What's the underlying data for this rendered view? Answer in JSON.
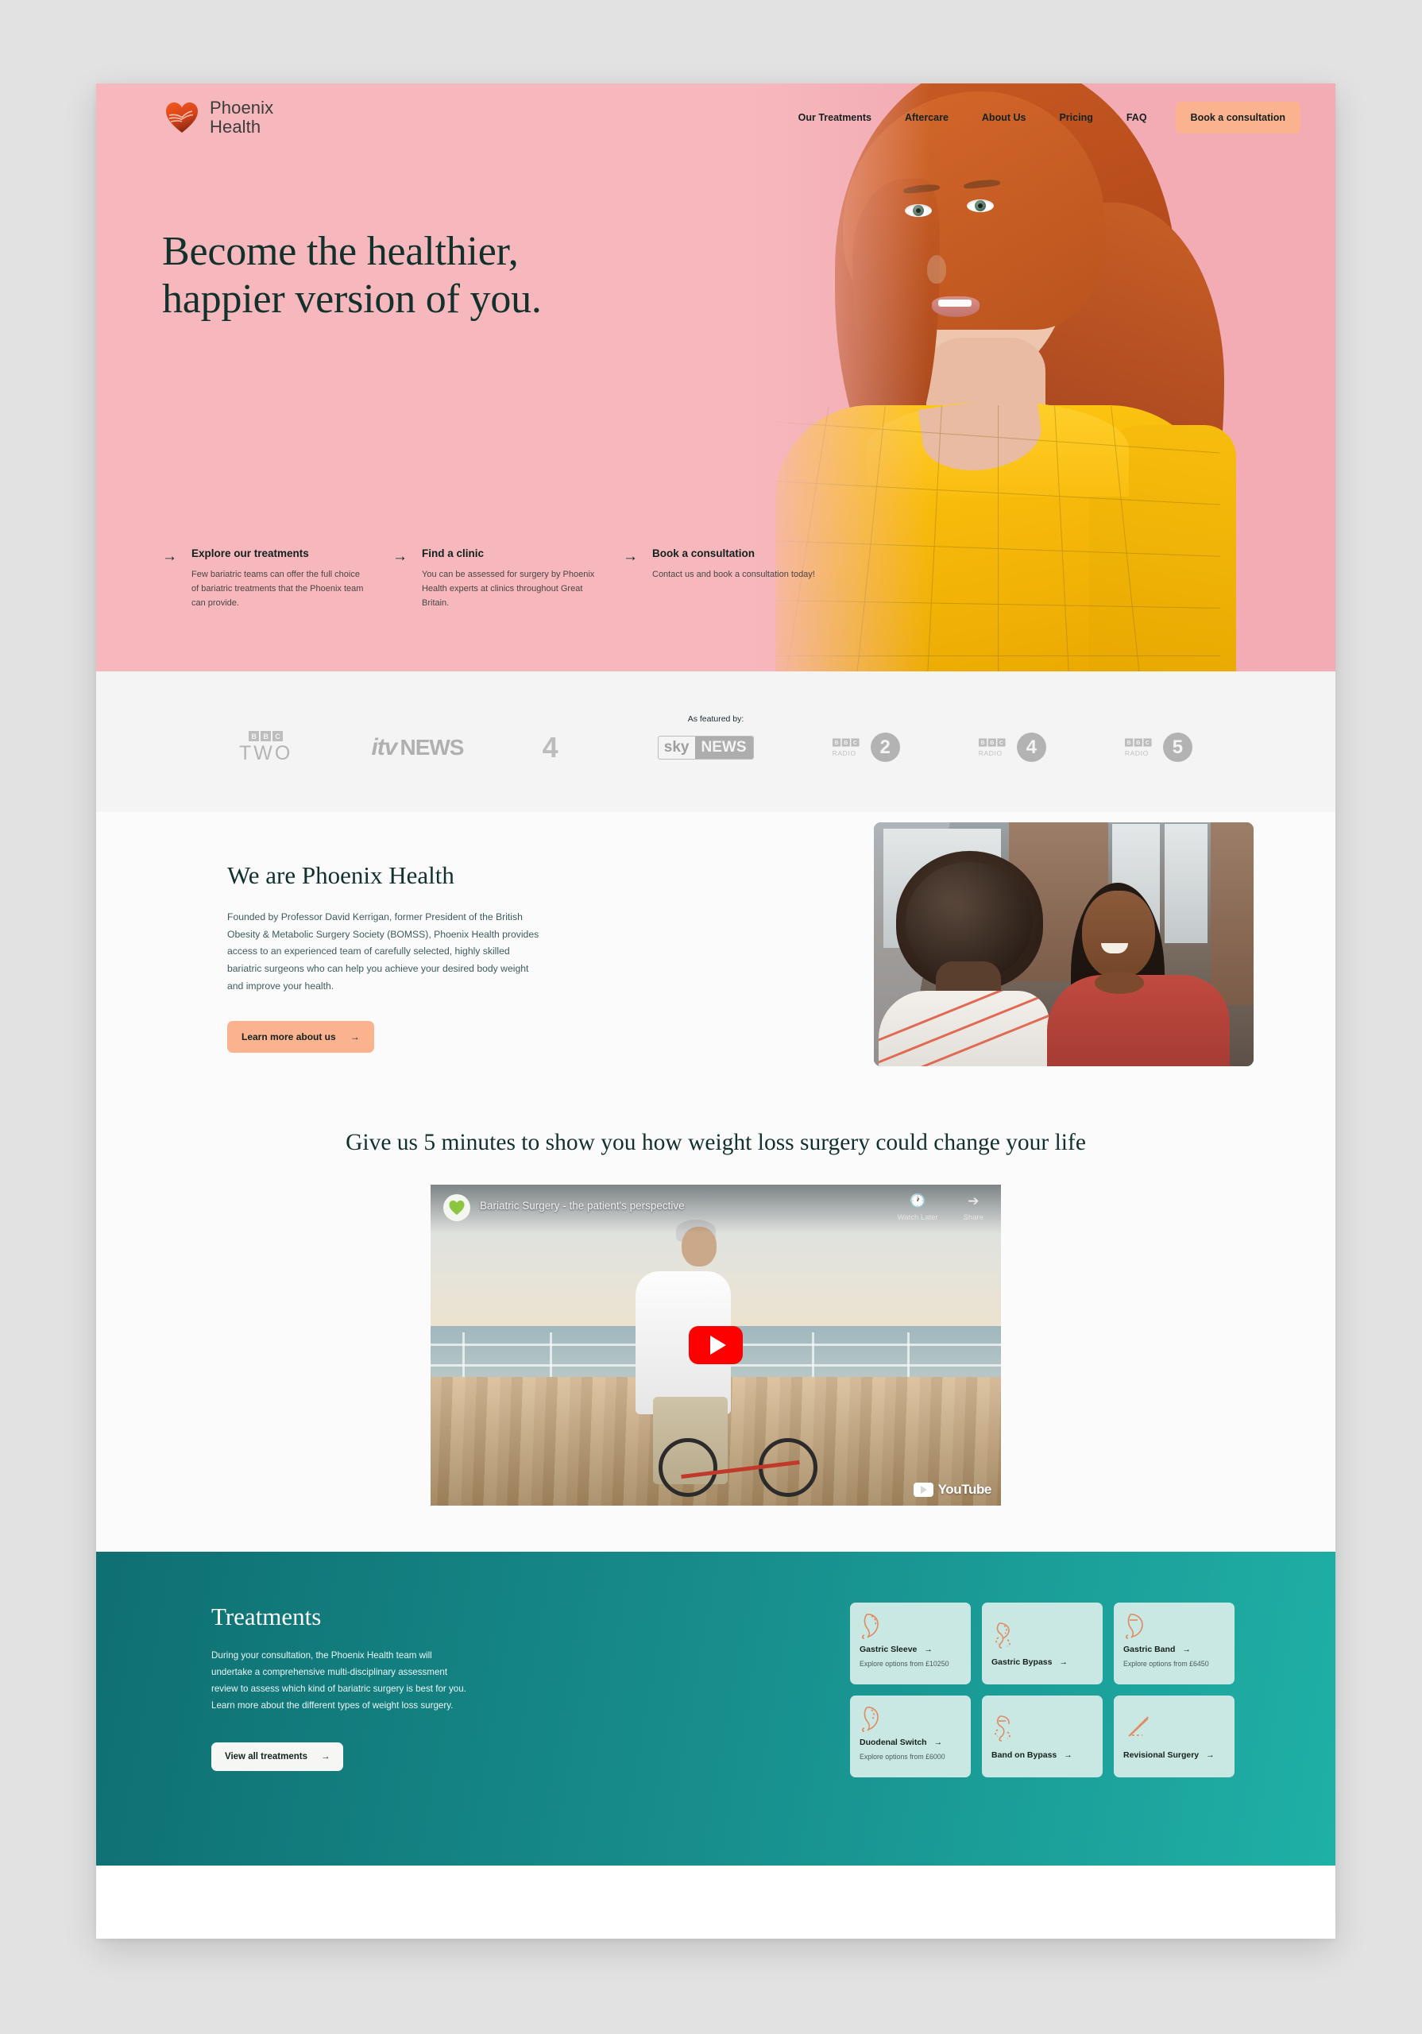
{
  "brand": {
    "name_line1": "Phoenix",
    "name_line2": "Health",
    "logo_icon": "phoenix-heart-logo"
  },
  "nav": {
    "links": [
      {
        "label": "Our Treatments"
      },
      {
        "label": "Aftercare"
      },
      {
        "label": "About Us"
      },
      {
        "label": "Pricing"
      },
      {
        "label": "FAQ"
      }
    ],
    "cta_label": "Book a consultation"
  },
  "hero": {
    "title_line1": "Become the healthier,",
    "title_line2": "happier version of you.",
    "ctas": [
      {
        "title": "Explore our treatments",
        "body": "Few bariatric teams can offer the full choice of bariatric treatments that the Phoenix team can provide.",
        "arrow": "→"
      },
      {
        "title": "Find a clinic",
        "body": "You can be assessed for surgery by Phoenix Health experts at clinics throughout Great Britain.",
        "arrow": "→"
      },
      {
        "title": "Book a consultation",
        "body": "Contact us and book a consultation today!",
        "arrow": "→"
      }
    ]
  },
  "press": {
    "label": "As featured by:",
    "logos": [
      {
        "name": "bbc-two-logo",
        "bbc": [
          "B",
          "B",
          "C"
        ],
        "word": "TWO"
      },
      {
        "name": "itv-news-logo",
        "mark": "itv",
        "word": "NEWS"
      },
      {
        "name": "channel-4-logo",
        "word": "4"
      },
      {
        "name": "sky-news-logo",
        "mark": "sky",
        "word": "NEWS"
      },
      {
        "name": "bbc-radio-2-logo",
        "bbc": [
          "B",
          "B",
          "C"
        ],
        "word": "RADIO",
        "num": "2"
      },
      {
        "name": "bbc-radio-4-logo",
        "bbc": [
          "B",
          "B",
          "C"
        ],
        "word": "RADIO",
        "num": "4"
      },
      {
        "name": "bbc-radio-5-logo",
        "bbc": [
          "B",
          "B",
          "C"
        ],
        "word": "RADIO",
        "num": "5"
      }
    ]
  },
  "about": {
    "heading": "We are Phoenix Health",
    "body": "Founded by Professor David Kerrigan, former President of the British Obesity & Metabolic Surgery Society (BOMSS), Phoenix Health provides access to an experienced team of carefully selected, highly skilled bariatric surgeons who can help you achieve your desired body weight and improve your health.",
    "button_label": "Learn more about us",
    "button_arrow": "→",
    "photo_alt": "two-women-talking-photo"
  },
  "video": {
    "heading": "Give us 5 minutes to show you how weight loss surgery could change your life",
    "title": "Bariatric Surgery - the patient's perspective",
    "watch_later_label": "Watch Later",
    "share_label": "Share",
    "brand_label": "YouTube",
    "channel_avatar": "phoenix-health-channel-avatar"
  },
  "treatments": {
    "heading": "Treatments",
    "body": "During your consultation, the Phoenix Health team will undertake a comprehensive multi-disciplinary assessment review to assess which kind of bariatric surgery is best for you. Learn more about the different types of weight loss surgery.",
    "button_label": "View all treatments",
    "button_arrow": "→",
    "cards": [
      {
        "name": "Gastric Sleeve",
        "price": "Explore options from £10250",
        "icon": "gastric-sleeve-icon",
        "arrow": "→"
      },
      {
        "name": "Gastric Bypass",
        "price": "",
        "icon": "gastric-bypass-icon",
        "arrow": "→"
      },
      {
        "name": "Gastric Band",
        "price": "Explore options from £6450",
        "icon": "gastric-band-icon",
        "arrow": "→"
      },
      {
        "name": "Duodenal Switch",
        "price": "Explore options from £6000",
        "icon": "duodenal-switch-icon",
        "arrow": "→"
      },
      {
        "name": "Band on Bypass",
        "price": "",
        "icon": "band-on-bypass-icon",
        "arrow": "→"
      },
      {
        "name": "Revisional Surgery",
        "price": "",
        "icon": "revisional-surgery-icon",
        "arrow": "→"
      }
    ]
  },
  "colors": {
    "hero_pink": "#f6b8bd",
    "peach_button": "#fbb28f",
    "dark_green": "#12312c",
    "teal_start": "#0f6f72",
    "teal_end": "#1fb0a6",
    "card_mint": "#c9e7e3",
    "press_grey": "#f4f4f4",
    "icon_orange": "#e08b62"
  }
}
